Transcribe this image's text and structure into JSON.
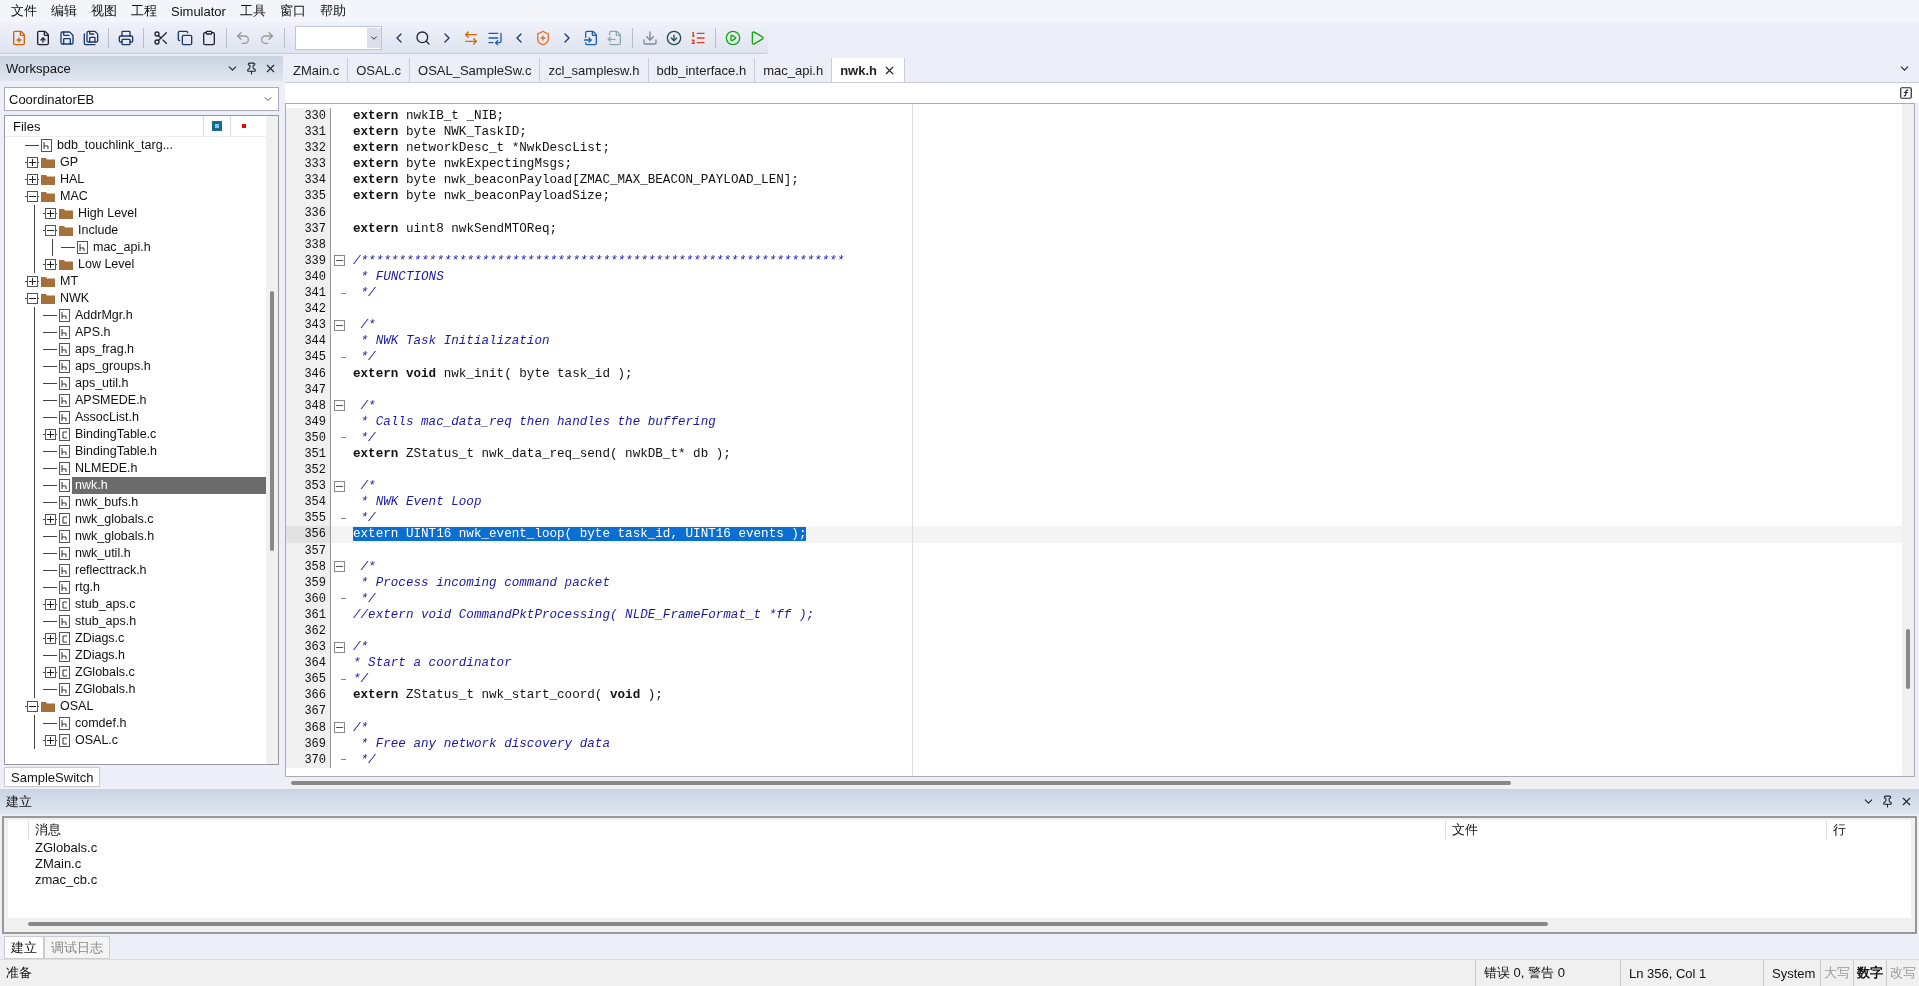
{
  "menu": [
    "文件",
    "编辑",
    "视图",
    "工程",
    "Simulator",
    "工具",
    "窗口",
    "帮助"
  ],
  "workspace": {
    "title": "Workspace",
    "configuration": "CoordinatorEB",
    "tree_header": "Files",
    "bottom_tab": "SampleSwitch",
    "tree": [
      {
        "label": "bdb_touchlink_targ...",
        "kind": "h",
        "selected": false
      },
      {
        "label": "GP",
        "kind": "folder",
        "expanded": false,
        "selected": false
      },
      {
        "label": "HAL",
        "kind": "folder",
        "expanded": false,
        "selected": false
      },
      {
        "label": "MAC",
        "kind": "folder",
        "expanded": true,
        "selected": false,
        "children": [
          {
            "label": "High Level",
            "kind": "folder",
            "expanded": false,
            "selected": false
          },
          {
            "label": "Include",
            "kind": "folder",
            "expanded": true,
            "selected": false,
            "children": [
              {
                "label": "mac_api.h",
                "kind": "h",
                "selected": false
              }
            ]
          },
          {
            "label": "Low Level",
            "kind": "folder",
            "expanded": false,
            "selected": false
          }
        ]
      },
      {
        "label": "MT",
        "kind": "folder",
        "expanded": false,
        "selected": false
      },
      {
        "label": "NWK",
        "kind": "folder",
        "expanded": true,
        "selected": false,
        "children": [
          {
            "label": "AddrMgr.h",
            "kind": "h",
            "selected": false
          },
          {
            "label": "APS.h",
            "kind": "h",
            "selected": false
          },
          {
            "label": "aps_frag.h",
            "kind": "h",
            "selected": false
          },
          {
            "label": "aps_groups.h",
            "kind": "h",
            "selected": false
          },
          {
            "label": "aps_util.h",
            "kind": "h",
            "selected": false
          },
          {
            "label": "APSMEDE.h",
            "kind": "h",
            "selected": false
          },
          {
            "label": "AssocList.h",
            "kind": "h",
            "selected": false
          },
          {
            "label": "BindingTable.c",
            "kind": "c",
            "expanded": false,
            "selected": false
          },
          {
            "label": "BindingTable.h",
            "kind": "h",
            "selected": false
          },
          {
            "label": "NLMEDE.h",
            "kind": "h",
            "selected": false
          },
          {
            "label": "nwk.h",
            "kind": "h",
            "selected": true
          },
          {
            "label": "nwk_bufs.h",
            "kind": "h",
            "selected": false
          },
          {
            "label": "nwk_globals.c",
            "kind": "c",
            "expanded": false,
            "selected": false
          },
          {
            "label": "nwk_globals.h",
            "kind": "h",
            "selected": false
          },
          {
            "label": "nwk_util.h",
            "kind": "h",
            "selected": false
          },
          {
            "label": "reflecttrack.h",
            "kind": "h",
            "selected": false
          },
          {
            "label": "rtg.h",
            "kind": "h",
            "selected": false
          },
          {
            "label": "stub_aps.c",
            "kind": "c",
            "expanded": false,
            "selected": false
          },
          {
            "label": "stub_aps.h",
            "kind": "h",
            "selected": false
          },
          {
            "label": "ZDiags.c",
            "kind": "c",
            "expanded": false,
            "selected": false
          },
          {
            "label": "ZDiags.h",
            "kind": "h",
            "selected": false
          },
          {
            "label": "ZGlobals.c",
            "kind": "c",
            "expanded": false,
            "selected": false
          },
          {
            "label": "ZGlobals.h",
            "kind": "h",
            "selected": false
          }
        ]
      },
      {
        "label": "OSAL",
        "kind": "folder",
        "expanded": true,
        "selected": false,
        "children": [
          {
            "label": "comdef.h",
            "kind": "h",
            "selected": false
          },
          {
            "label": "OSAL.c",
            "kind": "c",
            "expanded": false,
            "selected": false
          }
        ]
      }
    ]
  },
  "editor": {
    "tabs": [
      {
        "label": "ZMain.c",
        "selected": false
      },
      {
        "label": "OSAL.c",
        "selected": false
      },
      {
        "label": "OSAL_SampleSw.c",
        "selected": false
      },
      {
        "label": "zcl_samplesw.h",
        "selected": false
      },
      {
        "label": "bdb_interface.h",
        "selected": false
      },
      {
        "label": "mac_api.h",
        "selected": false
      },
      {
        "label": "nwk.h",
        "selected": true
      }
    ],
    "lines": [
      {
        "number": "330",
        "selected": false,
        "parts": [
          {
            "kind": "keyword",
            "text": "extern"
          },
          {
            "kind": "code",
            "text": " nwkIB_t _NIB;"
          }
        ]
      },
      {
        "number": "331",
        "selected": false,
        "parts": [
          {
            "kind": "keyword",
            "text": "extern"
          },
          {
            "kind": "code",
            "text": " byte NWK_TaskID;"
          }
        ]
      },
      {
        "number": "332",
        "selected": false,
        "parts": [
          {
            "kind": "keyword",
            "text": "extern"
          },
          {
            "kind": "code",
            "text": " networkDesc_t *NwkDescList;"
          }
        ]
      },
      {
        "number": "333",
        "selected": false,
        "parts": [
          {
            "kind": "keyword",
            "text": "extern"
          },
          {
            "kind": "code",
            "text": " byte nwkExpectingMsgs;"
          }
        ]
      },
      {
        "number": "334",
        "selected": false,
        "parts": [
          {
            "kind": "keyword",
            "text": "extern"
          },
          {
            "kind": "code",
            "text": " byte nwk_beaconPayload[ZMAC_MAX_BEACON_PAYLOAD_LEN];"
          }
        ]
      },
      {
        "number": "335",
        "selected": false,
        "parts": [
          {
            "kind": "keyword",
            "text": "extern"
          },
          {
            "kind": "code",
            "text": " byte nwk_beaconPayloadSize;"
          }
        ]
      },
      {
        "number": "336",
        "selected": false
      },
      {
        "number": "337",
        "selected": false,
        "parts": [
          {
            "kind": "keyword",
            "text": "extern"
          },
          {
            "kind": "code",
            "text": " uint8 nwkSendMTOReq;"
          }
        ]
      },
      {
        "number": "338",
        "selected": false
      },
      {
        "number": "339",
        "selected": false,
        "kind": "opener",
        "parts": [
          {
            "kind": "comment",
            "text": "/****************************************************************"
          }
        ]
      },
      {
        "number": "340",
        "selected": false,
        "parts": [
          {
            "kind": "comment",
            "text": " * FUNCTIONS"
          }
        ]
      },
      {
        "number": "341",
        "selected": false,
        "kind": "closer",
        "parts": [
          {
            "kind": "comment",
            "text": " */"
          }
        ]
      },
      {
        "number": "342",
        "selected": false
      },
      {
        "number": "343",
        "selected": false,
        "kind": "opener",
        "parts": [
          {
            "kind": "comment",
            "text": " /*"
          }
        ]
      },
      {
        "number": "344",
        "selected": false,
        "parts": [
          {
            "kind": "comment",
            "text": " * NWK Task Initialization"
          }
        ]
      },
      {
        "number": "345",
        "selected": false,
        "kind": "closer",
        "parts": [
          {
            "kind": "comment",
            "text": " */"
          }
        ]
      },
      {
        "number": "346",
        "selected": false,
        "parts": [
          {
            "kind": "keyword",
            "text": "extern void"
          },
          {
            "kind": "code",
            "text": " nwk_init( byte task_id );"
          }
        ]
      },
      {
        "number": "347",
        "selected": false
      },
      {
        "number": "348",
        "selected": false,
        "kind": "opener",
        "parts": [
          {
            "kind": "comment",
            "text": " /*"
          }
        ]
      },
      {
        "number": "349",
        "selected": false,
        "parts": [
          {
            "kind": "comment",
            "text": " * Calls mac_data_req then handles the buffering"
          }
        ]
      },
      {
        "number": "350",
        "selected": false,
        "kind": "closer",
        "parts": [
          {
            "kind": "comment",
            "text": " */"
          }
        ]
      },
      {
        "number": "351",
        "selected": false,
        "parts": [
          {
            "kind": "keyword",
            "text": "extern"
          },
          {
            "kind": "code",
            "text": " ZStatus_t nwk_data_req_send( nwkDB_t* db );"
          }
        ]
      },
      {
        "number": "352",
        "selected": false
      },
      {
        "number": "353",
        "selected": false,
        "kind": "opener",
        "parts": [
          {
            "kind": "comment",
            "text": " /*"
          }
        ]
      },
      {
        "number": "354",
        "selected": false,
        "parts": [
          {
            "kind": "comment",
            "text": " * NWK Event Loop"
          }
        ]
      },
      {
        "number": "355",
        "selected": false,
        "kind": "closer",
        "parts": [
          {
            "kind": "comment",
            "text": " */"
          }
        ]
      },
      {
        "number": "356",
        "selected": true,
        "parts": [
          {
            "kind": "code",
            "text": "extern UINT16 nwk_event_loop( byte task_id, UINT16 events );"
          }
        ]
      },
      {
        "number": "357",
        "selected": false
      },
      {
        "number": "358",
        "selected": false,
        "kind": "opener",
        "parts": [
          {
            "kind": "comment",
            "text": " /*"
          }
        ]
      },
      {
        "number": "359",
        "selected": false,
        "parts": [
          {
            "kind": "comment",
            "text": " * Process incoming command packet"
          }
        ]
      },
      {
        "number": "360",
        "selected": false,
        "kind": "closer",
        "parts": [
          {
            "kind": "comment",
            "text": " */"
          }
        ]
      },
      {
        "number": "361",
        "selected": false,
        "parts": [
          {
            "kind": "comment",
            "text": "//extern void CommandPktProcessing( NLDE_FrameFormat_t *ff );"
          }
        ]
      },
      {
        "number": "362",
        "selected": false
      },
      {
        "number": "363",
        "selected": false,
        "kind": "opener",
        "parts": [
          {
            "kind": "comment",
            "text": "/*"
          }
        ]
      },
      {
        "number": "364",
        "selected": false,
        "parts": [
          {
            "kind": "comment",
            "text": "* Start a coordinator"
          }
        ]
      },
      {
        "number": "365",
        "selected": false,
        "kind": "closer",
        "parts": [
          {
            "kind": "comment",
            "text": "*/"
          }
        ]
      },
      {
        "number": "366",
        "selected": false,
        "parts": [
          {
            "kind": "keyword",
            "text": "extern"
          },
          {
            "kind": "code",
            "text": " ZStatus_t nwk_start_coord( "
          },
          {
            "kind": "keyword",
            "text": "void"
          },
          {
            "kind": "code",
            "text": " );"
          }
        ]
      },
      {
        "number": "367",
        "selected": false
      },
      {
        "number": "368",
        "selected": false,
        "kind": "opener",
        "parts": [
          {
            "kind": "comment",
            "text": "/*"
          }
        ]
      },
      {
        "number": "369",
        "selected": false,
        "parts": [
          {
            "kind": "comment",
            "text": " * Free any network discovery data"
          }
        ]
      },
      {
        "number": "370",
        "selected": false,
        "kind": "closer",
        "parts": [
          {
            "kind": "comment",
            "text": " */"
          }
        ]
      }
    ]
  },
  "build": {
    "title": "建立",
    "columns": [
      "消息",
      "文件",
      "行"
    ],
    "rows": [
      {
        "message": "ZGlobals.c"
      },
      {
        "message": "ZMain.c"
      },
      {
        "message": "zmac_cb.c"
      }
    ],
    "tabs": [
      {
        "label": "建立",
        "selected": true
      },
      {
        "label": "调试日志",
        "selected": false
      }
    ]
  },
  "status_bar": {
    "message": "准备",
    "errors": "错误 0, 警告 0",
    "position": "Ln 356, Col 1",
    "encoding": "System",
    "indicators": [
      {
        "label": "大写",
        "on": false
      },
      {
        "label": "数字",
        "on": true
      },
      {
        "label": "改写",
        "on": false
      }
    ]
  }
}
